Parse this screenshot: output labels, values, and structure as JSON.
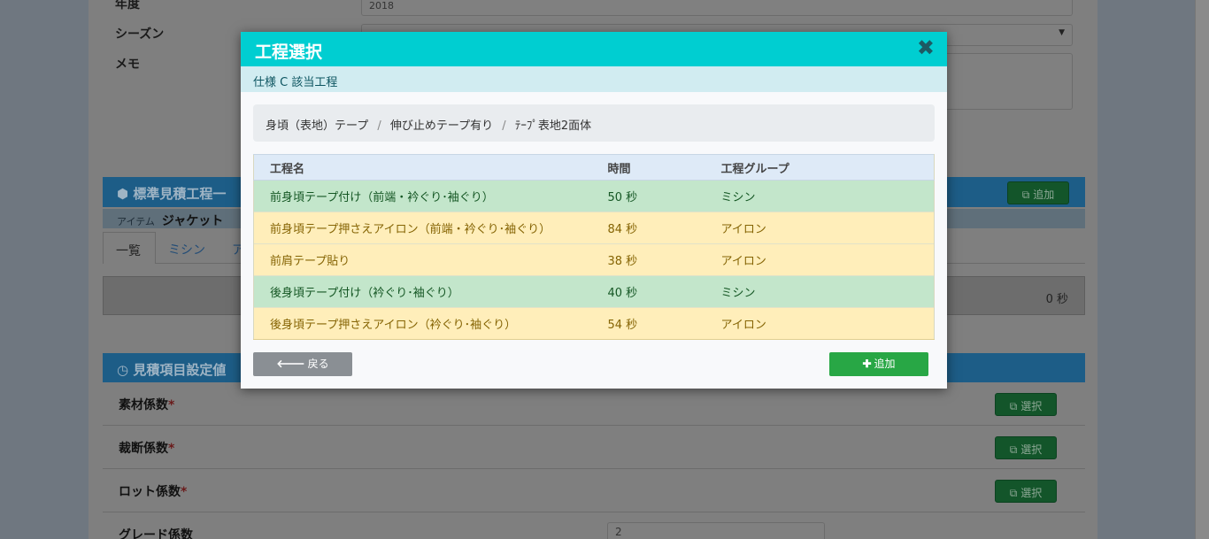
{
  "background": {
    "fields": {
      "year_label": "年度",
      "year_value": "2018",
      "season_label": "シーズン",
      "memo_label": "メモ"
    },
    "standard_panel": {
      "title": "標準見積工程一",
      "add_label": "追加",
      "item_label": "アイテム",
      "item_value": "ジャケット",
      "tabs": [
        "一覧",
        "ミシン",
        "ア"
      ],
      "total": "0 秒"
    },
    "settings_panel": {
      "title": "見積項目設定値",
      "rows": [
        {
          "label": "素材係数",
          "required": "*",
          "button": "選択"
        },
        {
          "label": "裁断係数",
          "required": "*",
          "button": "選択"
        },
        {
          "label": "ロット係数",
          "required": "*",
          "button": "選択"
        },
        {
          "label": "グレード係数",
          "value": "2"
        }
      ]
    }
  },
  "modal": {
    "title": "工程選択",
    "subtitle": "仕様 C 該当工程",
    "breadcrumb": [
      "身頃（表地）テープ",
      "伸び止めテープ有り",
      "ﾃｰﾌﾟ表地2面体"
    ],
    "breadcrumb_separator": "/",
    "table": {
      "headers": [
        "工程名",
        "時間",
        "工程グループ"
      ],
      "rows": [
        {
          "name": "前身頃テープ付け（前端・衿ぐり･袖ぐり）",
          "time": "50 秒",
          "group": "ミシン",
          "color": "#c3e6cb"
        },
        {
          "name": "前身頃テープ押さえアイロン（前端・衿ぐり･袖ぐり）",
          "time": "84 秒",
          "group": "アイロン",
          "color": "#ffeeba"
        },
        {
          "name": "前肩テープ貼り",
          "time": "38 秒",
          "group": "アイロン",
          "color": "#ffeeba"
        },
        {
          "name": "後身頃テープ付け（衿ぐり･袖ぐり）",
          "time": "40 秒",
          "group": "ミシン",
          "color": "#c3e6cb"
        },
        {
          "name": "後身頃テープ押さえアイロン（衿ぐり･袖ぐり）",
          "time": "54 秒",
          "group": "アイロン",
          "color": "#ffeeba"
        }
      ]
    },
    "back_label": "戻る",
    "add_label": "追加",
    "colors": {
      "header": "#00ced1",
      "add": "#28a745",
      "back": "#8a8f94"
    }
  }
}
